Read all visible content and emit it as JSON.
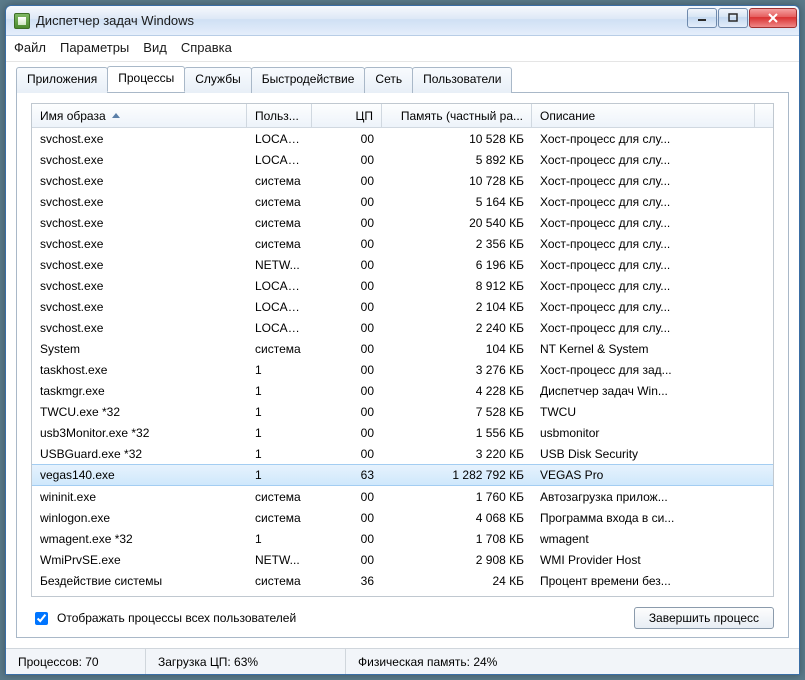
{
  "window": {
    "title": "Диспетчер задач Windows"
  },
  "menu": {
    "file": "Файл",
    "options": "Параметры",
    "view": "Вид",
    "help": "Справка"
  },
  "tabs": {
    "apps": "Приложения",
    "processes": "Процессы",
    "services": "Службы",
    "performance": "Быстродействие",
    "network": "Сеть",
    "users": "Пользователи"
  },
  "columns": {
    "name": "Имя образа",
    "user": "Польз...",
    "cpu": "ЦП",
    "mem": "Память (частный ра...",
    "desc": "Описание"
  },
  "rows": [
    {
      "name": "svchost.exe",
      "user": "LOCAL...",
      "cpu": "00",
      "mem": "10 528 КБ",
      "desc": "Хост-процесс для слу...",
      "sel": false
    },
    {
      "name": "svchost.exe",
      "user": "LOCAL...",
      "cpu": "00",
      "mem": "5 892 КБ",
      "desc": "Хост-процесс для слу...",
      "sel": false
    },
    {
      "name": "svchost.exe",
      "user": "система",
      "cpu": "00",
      "mem": "10 728 КБ",
      "desc": "Хост-процесс для слу...",
      "sel": false
    },
    {
      "name": "svchost.exe",
      "user": "система",
      "cpu": "00",
      "mem": "5 164 КБ",
      "desc": "Хост-процесс для слу...",
      "sel": false
    },
    {
      "name": "svchost.exe",
      "user": "система",
      "cpu": "00",
      "mem": "20 540 КБ",
      "desc": "Хост-процесс для слу...",
      "sel": false
    },
    {
      "name": "svchost.exe",
      "user": "система",
      "cpu": "00",
      "mem": "2 356 КБ",
      "desc": "Хост-процесс для слу...",
      "sel": false
    },
    {
      "name": "svchost.exe",
      "user": "NETW...",
      "cpu": "00",
      "mem": "6 196 КБ",
      "desc": "Хост-процесс для слу...",
      "sel": false
    },
    {
      "name": "svchost.exe",
      "user": "LOCAL...",
      "cpu": "00",
      "mem": "8 912 КБ",
      "desc": "Хост-процесс для слу...",
      "sel": false
    },
    {
      "name": "svchost.exe",
      "user": "LOCAL...",
      "cpu": "00",
      "mem": "2 104 КБ",
      "desc": "Хост-процесс для слу...",
      "sel": false
    },
    {
      "name": "svchost.exe",
      "user": "LOCAL...",
      "cpu": "00",
      "mem": "2 240 КБ",
      "desc": "Хост-процесс для слу...",
      "sel": false
    },
    {
      "name": "System",
      "user": "система",
      "cpu": "00",
      "mem": "104 КБ",
      "desc": "NT Kernel & System",
      "sel": false
    },
    {
      "name": "taskhost.exe",
      "user": "1",
      "cpu": "00",
      "mem": "3 276 КБ",
      "desc": "Хост-процесс для зад...",
      "sel": false
    },
    {
      "name": "taskmgr.exe",
      "user": "1",
      "cpu": "00",
      "mem": "4 228 КБ",
      "desc": "Диспетчер задач Win...",
      "sel": false
    },
    {
      "name": "TWCU.exe *32",
      "user": "1",
      "cpu": "00",
      "mem": "7 528 КБ",
      "desc": "TWCU",
      "sel": false
    },
    {
      "name": "usb3Monitor.exe *32",
      "user": "1",
      "cpu": "00",
      "mem": "1 556 КБ",
      "desc": "usbmonitor",
      "sel": false
    },
    {
      "name": "USBGuard.exe *32",
      "user": "1",
      "cpu": "00",
      "mem": "3 220 КБ",
      "desc": "USB Disk Security",
      "sel": false
    },
    {
      "name": "vegas140.exe",
      "user": "1",
      "cpu": "63",
      "mem": "1 282 792 КБ",
      "desc": "VEGAS Pro",
      "sel": true
    },
    {
      "name": "wininit.exe",
      "user": "система",
      "cpu": "00",
      "mem": "1 760 КБ",
      "desc": "Автозагрузка прилож...",
      "sel": false
    },
    {
      "name": "winlogon.exe",
      "user": "система",
      "cpu": "00",
      "mem": "4 068 КБ",
      "desc": "Программа входа в си...",
      "sel": false
    },
    {
      "name": "wmagent.exe *32",
      "user": "1",
      "cpu": "00",
      "mem": "1 708 КБ",
      "desc": "wmagent",
      "sel": false
    },
    {
      "name": "WmiPrvSE.exe",
      "user": "NETW...",
      "cpu": "00",
      "mem": "2 908 КБ",
      "desc": "WMI Provider Host",
      "sel": false
    },
    {
      "name": "Бездействие системы",
      "user": "система",
      "cpu": "36",
      "mem": "24 КБ",
      "desc": "Процент времени без...",
      "sel": false
    }
  ],
  "bottom": {
    "checkbox": "Отображать процессы всех пользователей",
    "endProcess": "Завершить процесс"
  },
  "status": {
    "processes": "Процессов: 70",
    "cpu": "Загрузка ЦП: 63%",
    "mem": "Физическая память: 24%"
  }
}
